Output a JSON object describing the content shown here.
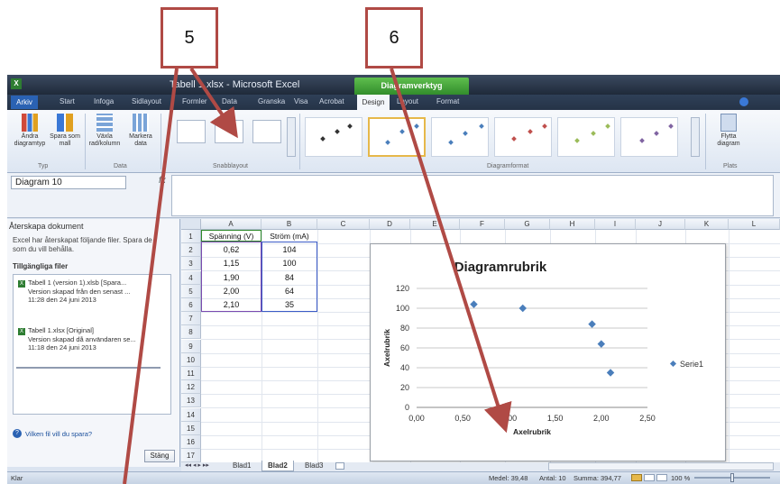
{
  "callouts": {
    "five": "5",
    "six": "6"
  },
  "window": {
    "title": "Tabell 1.xlsx - Microsoft Excel",
    "context_tab": "Diagramverktyg"
  },
  "tabs": {
    "file": "Arkiv",
    "home": "Start",
    "insert": "Infoga",
    "page": "Sidlayout",
    "formulas": "Formler",
    "data": "Data",
    "review": "Granska",
    "view": "Visa",
    "acrobat": "Acrobat",
    "design": "Design",
    "layout": "Layout",
    "format": "Format"
  },
  "ribbon": {
    "change_type": "Ändra diagramtyp",
    "save_template": "Spara som mall",
    "switch_rowcol": "Växla rad/kolumn",
    "select_data": "Markera data",
    "move_chart": "Flytta diagram",
    "groups": {
      "type": "Typ",
      "data": "Data",
      "quick_layout": "Snabblayout",
      "styles": "Diagramformat",
      "location": "Plats"
    }
  },
  "formula": {
    "name_box": "Diagram 10",
    "fx": "fx"
  },
  "pane": {
    "heading": "Återskapa dokument",
    "message": "Excel har återskapat följande filer. Spara de som du vill behålla.",
    "available": "Tillgängliga filer",
    "files": [
      {
        "name": "Tabell 1 (version 1).xlsb [Spara...",
        "desc": "Version skapad från den senast ...",
        "time": "11:28 den 24 juni 2013"
      },
      {
        "name": "Tabell 1.xlsx [Original]",
        "desc": "Version skapad då användaren se...",
        "time": "11:18 den 24 juni 2013"
      }
    ],
    "question": "Vilken fil vill du spara?",
    "close": "Stäng"
  },
  "grid": {
    "columns": [
      "A",
      "B",
      "C",
      "D",
      "E",
      "F",
      "G",
      "H",
      "I",
      "J",
      "K",
      "L"
    ],
    "rows": [
      "1",
      "2",
      "3",
      "4",
      "5",
      "6",
      "7",
      "8",
      "9",
      "10",
      "11",
      "12",
      "13",
      "14",
      "15",
      "16",
      "17"
    ],
    "header_a": "Spänning (V)",
    "header_b": "Ström (mA)",
    "data": [
      [
        "0,62",
        "104"
      ],
      [
        "1,15",
        "100"
      ],
      [
        "1,90",
        "84"
      ],
      [
        "2,00",
        "64"
      ],
      [
        "2,10",
        "35"
      ]
    ]
  },
  "sheets": {
    "s1": "Blad1",
    "s2": "Blad2",
    "s3": "Blad3"
  },
  "status": {
    "ready": "Klar",
    "avg": "Medel: 39,48",
    "count": "Antal: 10",
    "sum": "Summa: 394,77",
    "zoom": "100 %"
  },
  "chart_data": {
    "type": "scatter",
    "title": "Diagramrubrik",
    "xlabel": "Axelrubrik",
    "ylabel": "Axelrubrik",
    "xlim": [
      0,
      2.5
    ],
    "ylim": [
      0,
      120
    ],
    "xticks": [
      "0,00",
      "0,50",
      "1,00",
      "1,50",
      "2,00",
      "2,50"
    ],
    "yticks": [
      "0",
      "20",
      "40",
      "60",
      "80",
      "100",
      "120"
    ],
    "series": [
      {
        "name": "Serie1",
        "x": [
          0.62,
          1.15,
          1.9,
          2.0,
          2.1
        ],
        "y": [
          104,
          100,
          84,
          64,
          35
        ]
      }
    ],
    "legend": "right",
    "grid": true,
    "marker_color": "#4a7ebb"
  }
}
